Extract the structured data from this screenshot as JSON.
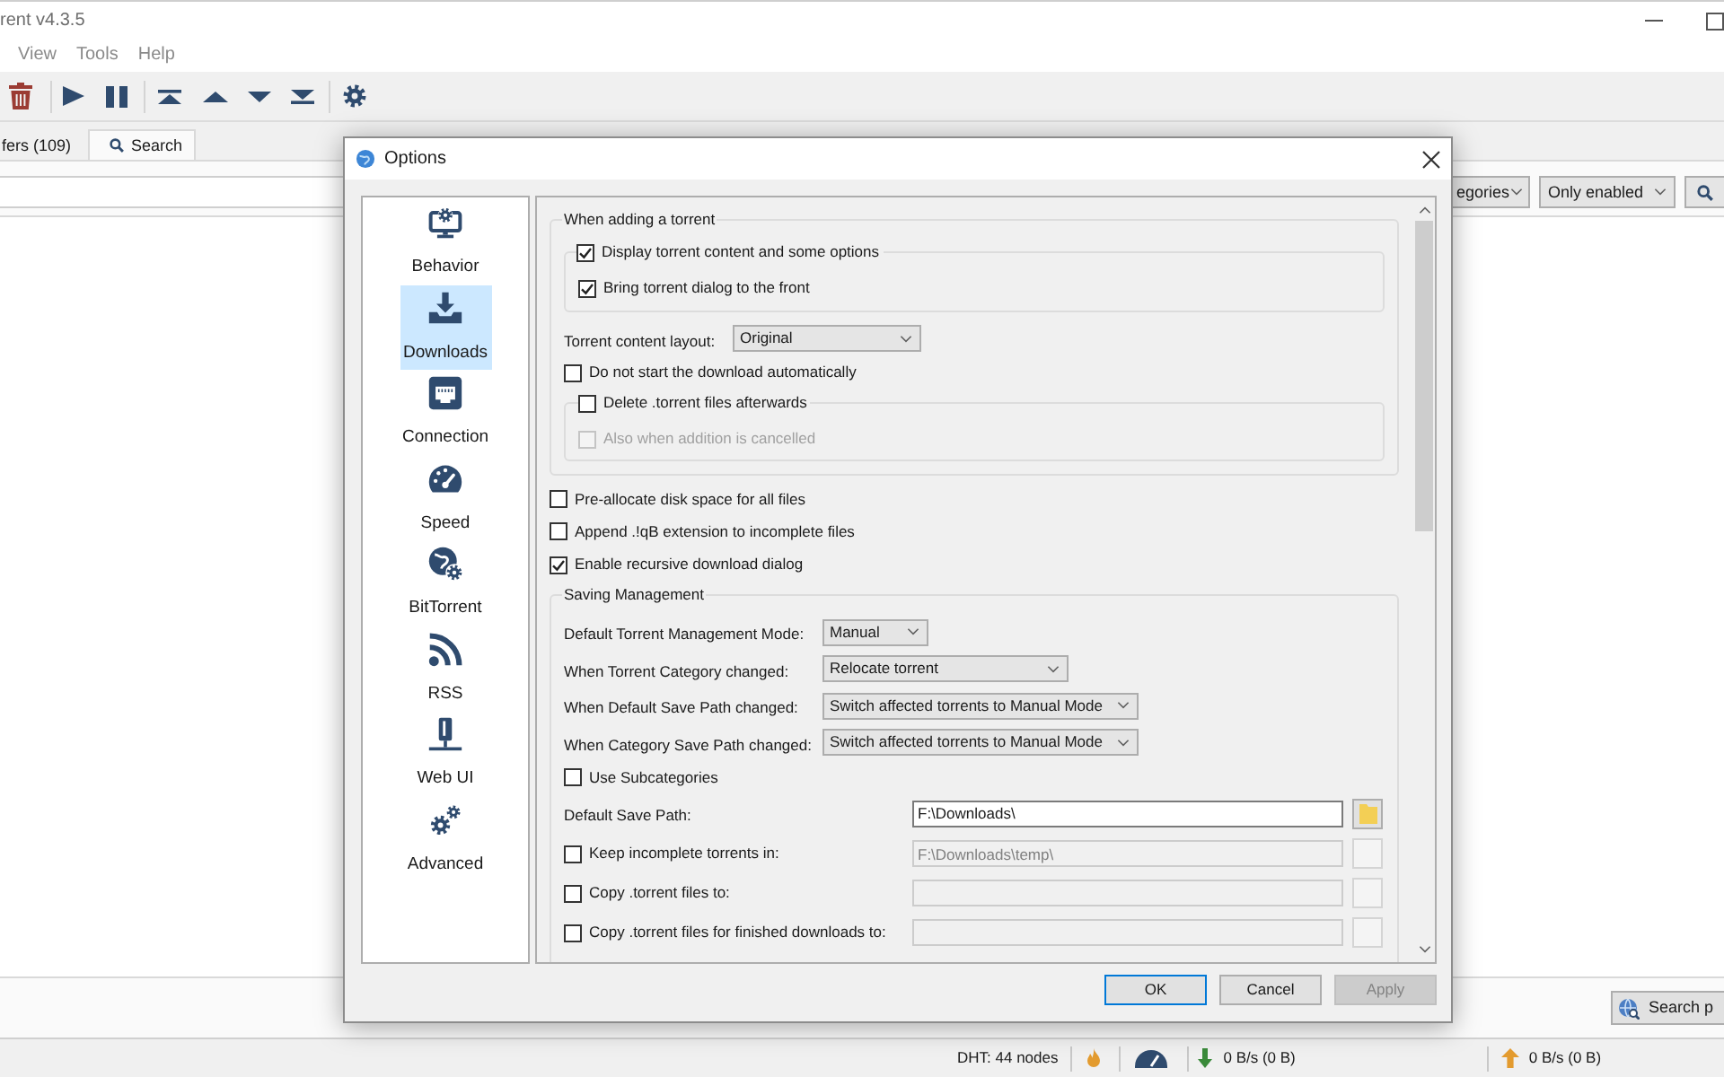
{
  "app_window": {
    "title": "rent v4.3.5",
    "menu": [
      "View",
      "Tools",
      "Help"
    ]
  },
  "tabs": [
    {
      "label": "fers (109)",
      "selected": false
    },
    {
      "label": "Search",
      "selected": true
    }
  ],
  "search_filters": [
    "egories",
    "Only enabled"
  ],
  "search_plugins_button": "Search p",
  "status_bar": {
    "dht": "DHT: 44 nodes",
    "download_speed": "0 B/s (0 B)",
    "upload_speed": "0 B/s (0 B)"
  },
  "options_dialog": {
    "title": "Options",
    "categories": [
      {
        "label": "Behavior",
        "selected": false
      },
      {
        "label": "Downloads",
        "selected": true
      },
      {
        "label": "Connection",
        "selected": false
      },
      {
        "label": "Speed",
        "selected": false
      },
      {
        "label": "BitTorrent",
        "selected": false
      },
      {
        "label": "RSS",
        "selected": false
      },
      {
        "label": "Web UI",
        "selected": false
      },
      {
        "label": "Advanced",
        "selected": false
      }
    ],
    "adding_torrent": {
      "title": "When adding a torrent",
      "dialog_group": {
        "label": "Display torrent content and some options",
        "checked": true,
        "options": [
          {
            "label": "Bring torrent dialog to the front",
            "checked": true
          }
        ]
      },
      "content_layout": {
        "label": "Torrent content layout:",
        "value": "Original"
      },
      "no_autostart": {
        "label": "Do not start the download automatically",
        "checked": false
      },
      "delete_group": {
        "label": "Delete .torrent files afterwards",
        "checked": false,
        "options": [
          {
            "label": "Also when addition is cancelled",
            "checked": false,
            "disabled": true
          }
        ]
      }
    },
    "options": [
      {
        "label": "Pre-allocate disk space for all files",
        "checked": false
      },
      {
        "label": "Append .!qB extension to incomplete files",
        "checked": false
      },
      {
        "label": "Enable recursive download dialog",
        "checked": true
      }
    ],
    "saving_management": {
      "title": "Saving Management",
      "modes": [
        {
          "label": "Default Torrent Management Mode:",
          "value": "Manual"
        },
        {
          "label": "When Torrent Category changed:",
          "value": "Relocate torrent"
        },
        {
          "label": "When Default Save Path changed:",
          "value": "Switch affected torrents to Manual Mode"
        },
        {
          "label": "When Category Save Path changed:",
          "value": "Switch affected torrents to Manual Mode"
        }
      ],
      "subcategories": {
        "label": "Use Subcategories",
        "checked": false
      },
      "paths": [
        {
          "kind": "plain",
          "label": "Default Save Path:",
          "value": "F:\\Downloads\\",
          "disabled": false
        },
        {
          "kind": "checkbox",
          "label": "Keep incomplete torrents in:",
          "checked": false,
          "value": "F:\\Downloads\\temp\\",
          "disabled": true
        },
        {
          "kind": "checkbox",
          "label": "Copy .torrent files to:",
          "checked": false,
          "disabled": true
        },
        {
          "kind": "checkbox",
          "label": "Copy .torrent files for finished downloads to:",
          "checked": false,
          "disabled": true
        }
      ]
    },
    "buttons": [
      {
        "label": "OK",
        "default": true,
        "disabled": false
      },
      {
        "label": "Cancel",
        "default": false,
        "disabled": false
      },
      {
        "label": "Apply",
        "default": false,
        "disabled": true
      }
    ]
  }
}
